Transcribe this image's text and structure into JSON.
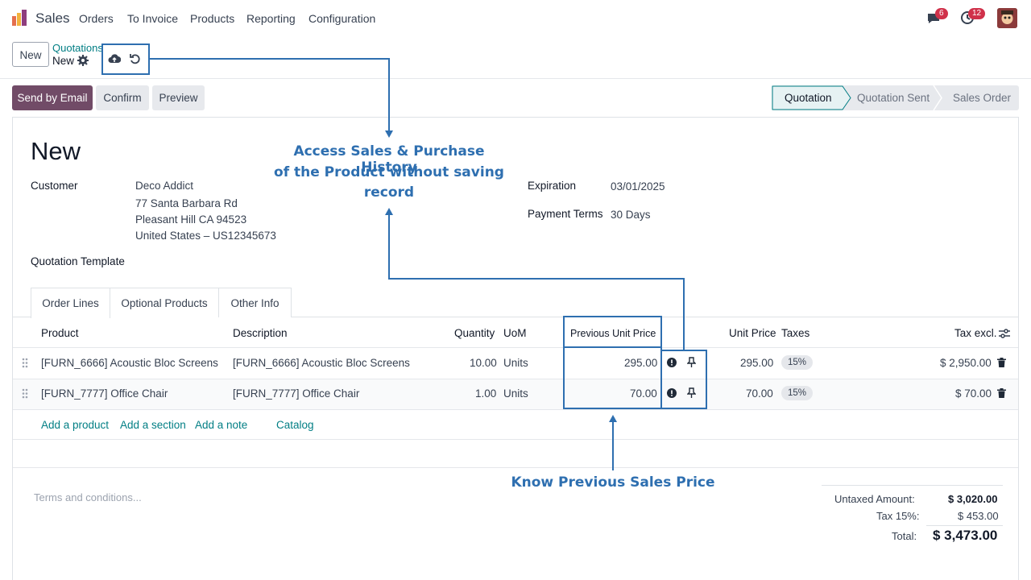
{
  "navbar": {
    "app_name": "Sales",
    "menu": [
      "Orders",
      "To Invoice",
      "Products",
      "Reporting",
      "Configuration"
    ],
    "messages_count": "6",
    "activities_count": "12"
  },
  "control_panel": {
    "new_button": "New",
    "breadcrumb_parent": "Quotations",
    "breadcrumb_current": "New"
  },
  "actions": {
    "send_email": "Send by Email",
    "confirm": "Confirm",
    "preview": "Preview"
  },
  "statusbar": [
    "Quotation",
    "Quotation Sent",
    "Sales Order"
  ],
  "form": {
    "title": "New",
    "customer_label": "Customer",
    "customer_name": "Deco Addict",
    "address_1": "77 Santa Barbara Rd",
    "address_2": "Pleasant Hill CA 94523",
    "address_3": "United States – US12345673",
    "template_label": "Quotation Template",
    "expiration_label": "Expiration",
    "expiration_value": "03/01/2025",
    "payment_terms_label": "Payment Terms",
    "payment_terms_value": "30 Days"
  },
  "tabs": [
    "Order Lines",
    "Optional Products",
    "Other Info"
  ],
  "table": {
    "headers": {
      "product": "Product",
      "description": "Description",
      "quantity": "Quantity",
      "uom": "UoM",
      "prev_price": "Previous Unit Price",
      "unit_price": "Unit Price",
      "taxes": "Taxes",
      "tax_excl": "Tax excl."
    },
    "rows": [
      {
        "product": "[FURN_6666] Acoustic Bloc Screens",
        "description": "[FURN_6666] Acoustic Bloc Screens",
        "quantity": "10.00",
        "uom": "Units",
        "prev_price": "295.00",
        "unit_price": "295.00",
        "tax": "15%",
        "subtotal": "$ 2,950.00"
      },
      {
        "product": "[FURN_7777] Office Chair",
        "description": "[FURN_7777] Office Chair",
        "quantity": "1.00",
        "uom": "Units",
        "prev_price": "70.00",
        "unit_price": "70.00",
        "tax": "15%",
        "subtotal": "$ 70.00"
      }
    ],
    "add_product": "Add a product",
    "add_section": "Add a section",
    "add_note": "Add a note",
    "catalog": "Catalog"
  },
  "terms_placeholder": "Terms and conditions...",
  "totals": {
    "untaxed_label": "Untaxed Amount:",
    "untaxed_value": "$ 3,020.00",
    "tax_label": "Tax 15%:",
    "tax_value": "$ 453.00",
    "total_label": "Total:",
    "total_value": "$ 3,473.00"
  },
  "annotations": {
    "history_line1": "Access Sales & Purchase History",
    "history_line2": "of the Product without saving",
    "history_line3": "record",
    "previous_price": "Know Previous Sales Price"
  },
  "colors": {
    "primary": "#714b67",
    "link": "#017e84",
    "annotation": "#2e6fb0",
    "badge": "#d0314a"
  }
}
